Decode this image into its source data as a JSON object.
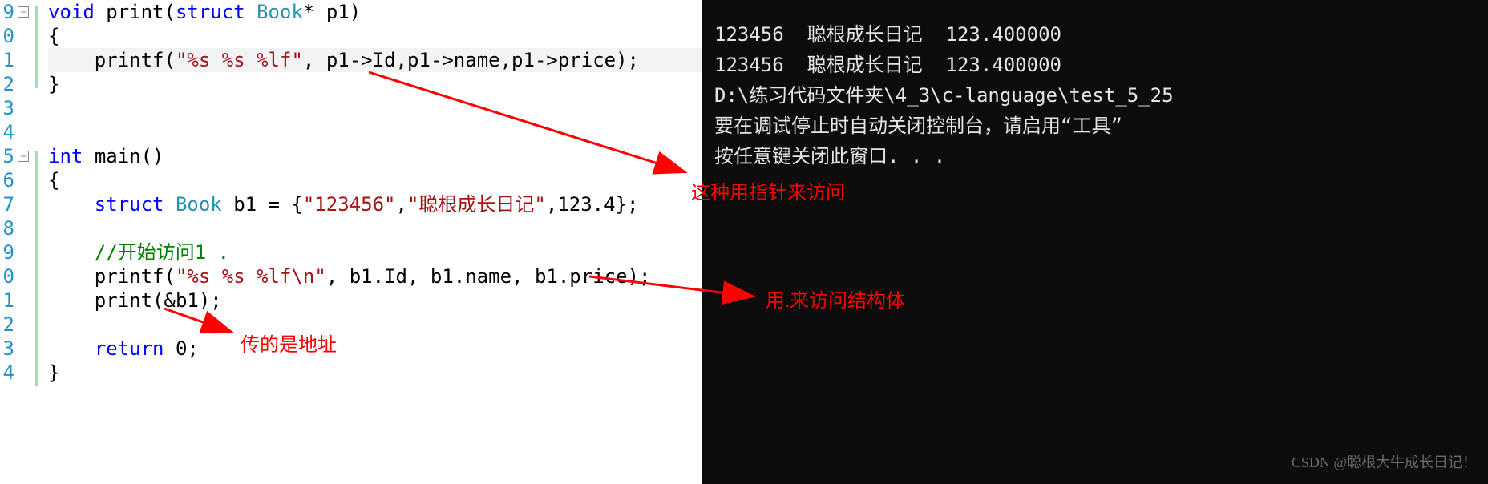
{
  "editor": {
    "lineNumbers": [
      "9",
      "0",
      "1",
      "2",
      "3",
      "4",
      "5",
      "6",
      "7",
      "8",
      "9",
      "0",
      "1",
      "2",
      "3",
      "4"
    ],
    "tokens": {
      "void": "void",
      "struct": "struct",
      "Book": "Book",
      "int": "int",
      "return": "return",
      "print": "print",
      "main": "main",
      "printf": "printf",
      "p1": "p1",
      "b1": "b1",
      "fmt1": "\"%s %s %lf\"",
      "fmt2": "\"%s %s %lf\\n\"",
      "Id": "Id",
      "name": "name",
      "price": "price",
      "init_id": "\"123456\"",
      "init_name": "\"聪根成长日记\"",
      "init_price": "123.4",
      "comment": "//开始访问1 .",
      "zero": "0"
    }
  },
  "terminal": {
    "l1": "123456  聪根成长日记  123.400000",
    "l2": "123456  聪根成长日记  123.400000",
    "l3": "D:\\练习代码文件夹\\4_3\\c-language\\test_5_25",
    "l4": "要在调试停止时自动关闭控制台，请启用“工具”",
    "l5": "按任意键关闭此窗口. . ."
  },
  "annotations": {
    "a1": "这种用指针来访问",
    "a2": "用.来访问结构体",
    "a3": "传的是地址"
  },
  "watermark": "CSDN @聪根大牛成长日记！"
}
